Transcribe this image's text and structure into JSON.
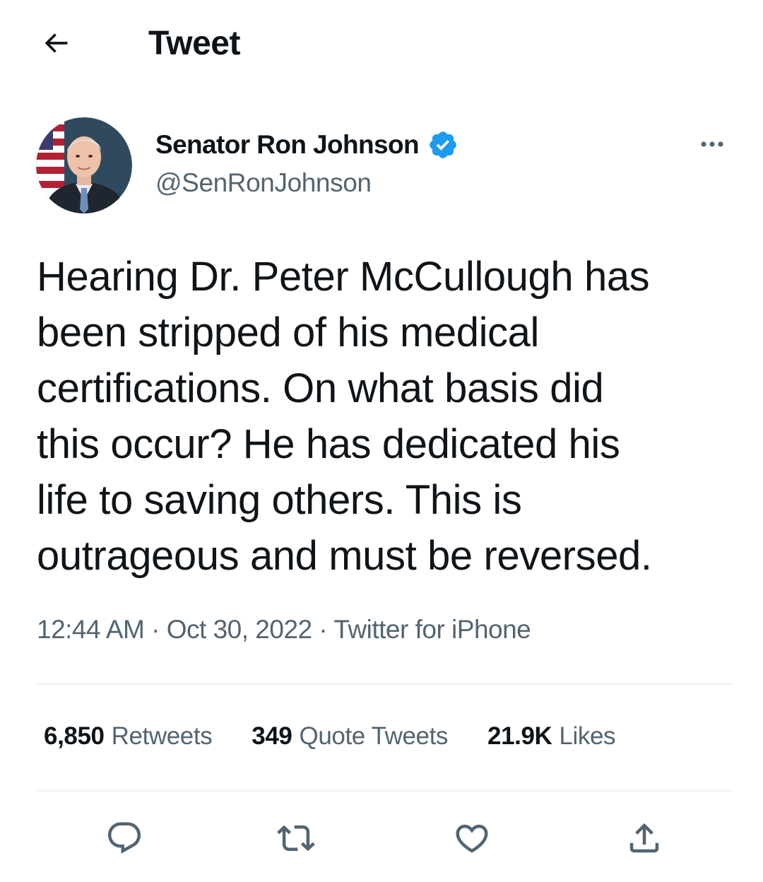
{
  "header": {
    "back_icon": "arrow-left-icon",
    "title": "Tweet"
  },
  "author": {
    "name": "Senator Ron Johnson",
    "handle": "@SenRonJohnson",
    "verified": true,
    "verified_color": "#1d9bf0",
    "more_icon": "more-horizontal-icon"
  },
  "tweet": {
    "text": "Hearing Dr. Peter McCullough has\nbeen stripped of his medical\ncertifications. On what basis did\nthis occur? He has dedicated his\nlife to saving others. This is\noutrageous and must be reversed."
  },
  "meta": {
    "time": "12:44 AM",
    "separator": "·",
    "date": "Oct 30, 2022",
    "source": "Twitter for iPhone"
  },
  "stats": {
    "retweets": {
      "count": "6,850",
      "label": "Retweets"
    },
    "quotes": {
      "count": "349",
      "label": "Quote Tweets"
    },
    "likes": {
      "count": "21.9K",
      "label": "Likes"
    }
  },
  "actions": {
    "reply_icon": "reply-icon",
    "retweet_icon": "retweet-icon",
    "like_icon": "heart-icon",
    "share_icon": "share-icon"
  },
  "colors": {
    "text": "#0f1419",
    "secondary": "#536471",
    "divider": "#eff3f4",
    "accent": "#1d9bf0"
  }
}
